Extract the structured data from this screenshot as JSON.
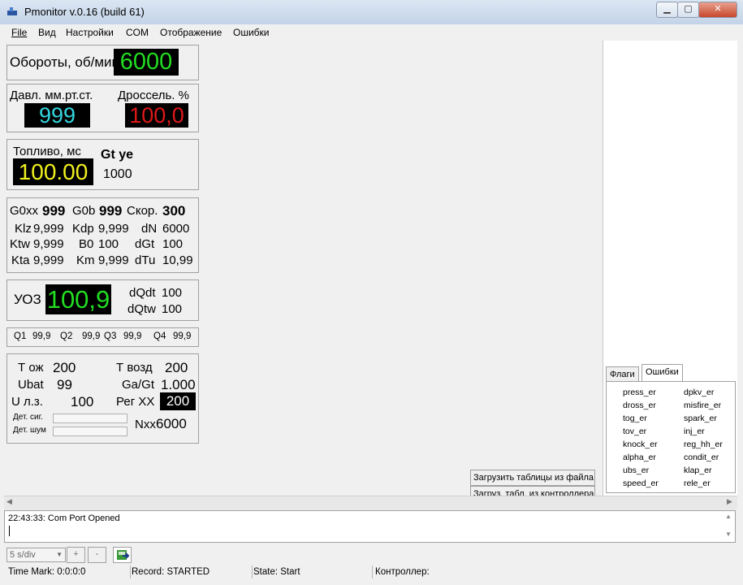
{
  "window": {
    "title": "Pmonitor v.0.16 (build 61)",
    "minimize_icon": "minimize-icon",
    "maximize_icon": "maximize-icon",
    "close_icon": "close-icon"
  },
  "menu": [
    "File",
    "Вид",
    "Настройки",
    "COM",
    "Отображение",
    "Ошибки"
  ],
  "rpm": {
    "label": "Обороты, об/мин",
    "value": "6000"
  },
  "pressure": {
    "label": "Давл. мм.рт.ст.",
    "value": "999"
  },
  "throttle": {
    "label": "Дроссель. %",
    "value": "100,0"
  },
  "fuel": {
    "label": "Топливо, мс",
    "value": "100.00",
    "gt_label": "Gt ye",
    "gt_value": "1000"
  },
  "params": {
    "g0xx_label": "G0xx",
    "g0xx": "999",
    "g0b_label": "G0b",
    "g0b": "999",
    "skor_label": "Скор.",
    "skor": "300",
    "klz_label": "Klz",
    "klz": "9,999",
    "kdp_label": "Kdp",
    "kdp": "9,999",
    "dn_label": "dN",
    "dn": "6000",
    "ktw_label": "Ktw",
    "ktw": "9,999",
    "b0_label": "B0",
    "b0": "100",
    "dgt_label": "dGt",
    "dgt": "100",
    "kta_label": "Kta",
    "kta": "9,999",
    "km_label": "Km",
    "km": "9,999",
    "dtu_label": "dTu",
    "dtu": "10,99"
  },
  "uoz": {
    "label": "УОЗ",
    "value": "100,9",
    "dqdt_label": "dQdt",
    "dqdt": "100",
    "dqtw_label": "dQtw",
    "dqtw": "100"
  },
  "q": {
    "q1_label": "Q1",
    "q1": "99,9",
    "q2_label": "Q2",
    "q2": "99,9",
    "q3_label": "Q3",
    "q3": "99,9",
    "q4_label": "Q4",
    "q4": "99,9"
  },
  "temps": {
    "toj_label": "Т ож",
    "toj": "200",
    "tvozd_label": "Т возд",
    "tvozd": "200",
    "ubat_label": "Ubat",
    "ubat": "99",
    "gagt_label": "Ga/Gt",
    "gagt": "1.000",
    "ulz_label": "U л.з.",
    "ulz": "100",
    "regxx_label": "Рег XX",
    "regxx": "200",
    "det_sig_label": "Дет. сиг.",
    "det_noise_label": "Дет. шум",
    "nxx_label": "Nxx",
    "nxx": "6000"
  },
  "tabs": {
    "flags": "Флаги",
    "errors": "Ошибки"
  },
  "errors_left": [
    "press_er",
    "dross_er",
    "tog_er",
    "tov_er",
    "knock_er",
    "alpha_er",
    "ubs_er",
    "speed_er"
  ],
  "errors_right": [
    "dpkv_er",
    "misfire_er",
    "spark_er",
    "inj_er",
    "reg_hh_er",
    "condit_er",
    "klap_er",
    "rele_er"
  ],
  "buttons": {
    "load_file": "Загрузить таблицы из файла",
    "load_ctrl": "Загруз. табл. из контроллера"
  },
  "log": {
    "line1": "22:43:33: Com Port Opened"
  },
  "toolbar": {
    "speed": "5 s/div",
    "plus": "+",
    "minus": "-"
  },
  "status": {
    "time_mark": "Time Mark: 0:0:0:0",
    "record": "Record: STARTED",
    "state": "State: Start",
    "controller": "Контроллер:"
  },
  "colors": {
    "lcd_green": "#22dd22",
    "lcd_cyan": "#33d6e0",
    "lcd_red": "#e01818",
    "lcd_yellow": "#f0f020"
  }
}
